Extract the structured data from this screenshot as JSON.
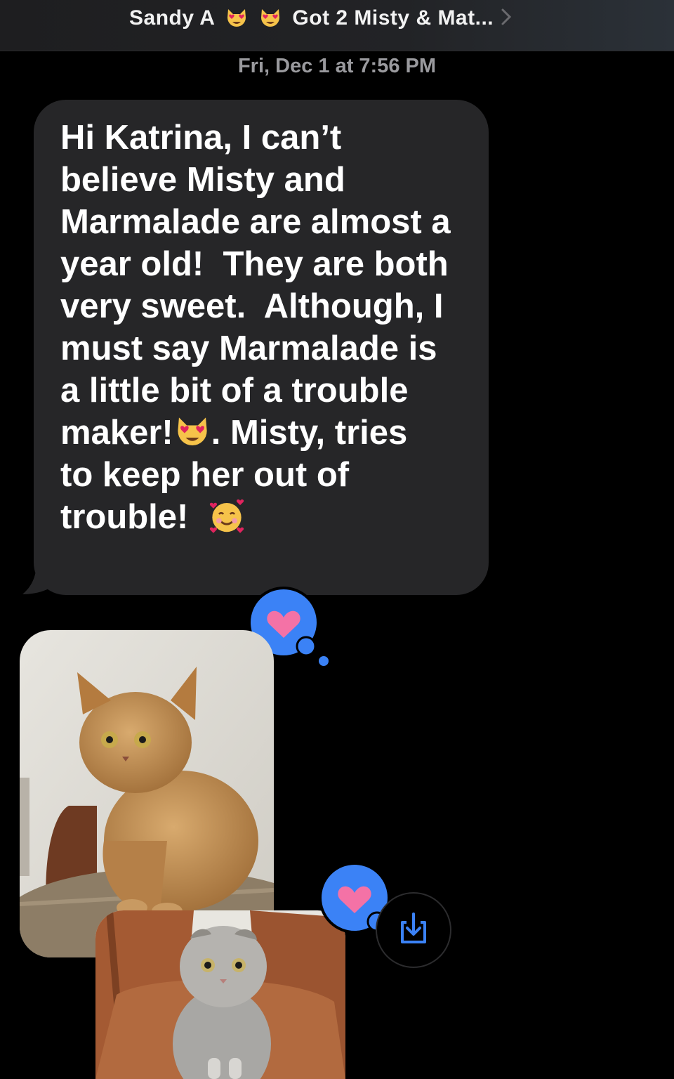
{
  "header": {
    "contact_name": "Sandy A",
    "conversation_title": "Got 2 Misty & Mat...",
    "emoji_icons": [
      "heart-eyes-cat-emoji",
      "heart-eyes-cat-emoji"
    ]
  },
  "conversation": {
    "timestamp": "Fri, Dec 1 at 7:56 PM",
    "message": {
      "text_part_1": "Hi Katrina, I can’t\nbelieve Misty and\nMarmalade are almost a\nyear old!  They are both\nvery sweet.  Although, I\nmust say Marmalade is\na little bit of a trouble\nmaker!",
      "text_part_2": ". Misty, tries\nto keep her out of\ntrouble!  ",
      "emojis": [
        "heart-eyes-cat-emoji",
        "smiling-face-with-hearts-emoji"
      ],
      "reaction": "heart"
    },
    "photos": [
      {
        "subject": "orange-cat-photo",
        "reaction": "heart"
      },
      {
        "subject": "grey-scottish-fold-cat-photo"
      }
    ]
  },
  "colors": {
    "background": "#000000",
    "bubble": "#262628",
    "reaction_blue": "#3b82f6",
    "heart_pink": "#f472a6",
    "timestamp": "#9a9a9e"
  }
}
